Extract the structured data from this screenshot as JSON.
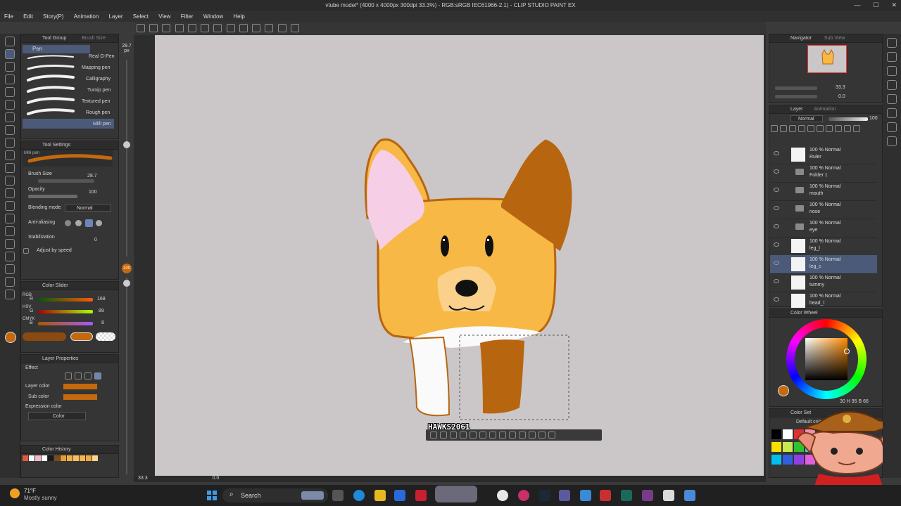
{
  "title_bar": {
    "text": "vtube model* (4000 x 4000px 300dpi 33.3%) - RGB:sRGB IEC61966-2.1) - CLIP STUDIO PAINT EX",
    "min": "—",
    "max": "☐",
    "close": "✕"
  },
  "menu": [
    "File",
    "Edit",
    "Story(P)",
    "Animation",
    "Layer",
    "Select",
    "View",
    "Filter",
    "Window",
    "Help"
  ],
  "tool_group": {
    "tab1": "Tool Group",
    "tab2": "Brush Size",
    "selected_tool": "Pen",
    "size_readout": "28.7",
    "size_unit": "px",
    "brushes": [
      "Real G-Pen",
      "Mapping pen",
      "Calligraphy",
      "Turnip pen",
      "Textured pen",
      "Rough pen",
      "Milli pen"
    ]
  },
  "tool_settings": {
    "header": "Tool Settings",
    "preview_label": "Milli pen",
    "brush_size_label": "Brush Size",
    "brush_size_value": "28.7",
    "opacity_label": "Opacity",
    "opacity_value": "100",
    "blending_label": "Blending mode",
    "blending_value": "Normal",
    "antialias_label": "Anti-aliasing",
    "stabilization_label": "Stabilization",
    "stabilization_value": "0",
    "adjust_speed_label": "Adjust by speed",
    "opacity_indicator": "100"
  },
  "color_slider": {
    "header": "Color Slider",
    "r_label": "R",
    "r_value": "168",
    "g_label": "G",
    "g_value": "89",
    "b_label": "B",
    "b_value": "8",
    "modes": [
      "RGB",
      "HSV",
      "CMYK"
    ]
  },
  "layer_properties": {
    "header": "Layer Properties",
    "effect_label": "Effect",
    "layer_color_label": "Layer color",
    "sub_color_label": "Sub color",
    "expression_label": "Expression color",
    "expression_value": "Color",
    "layer_color": "#c4690e"
  },
  "color_history": {
    "header": "Color History",
    "colors": [
      "#e05a3a",
      "#f7f7f7",
      "#f1b8c8",
      "#ffffff",
      "#1a1a1a",
      "#7a4a20",
      "#e6a030",
      "#f0b040",
      "#f5c060",
      "#f8b54a",
      "#f2a83c",
      "#fcd68a"
    ]
  },
  "canvas": {
    "watermark": "HAWKS2061",
    "status_zoom": "33.3",
    "status_angle": "0.0"
  },
  "navigator": {
    "tab1": "Navigator",
    "tab2": "Sub View",
    "zoom_value": "33.3",
    "angle_value": "0.0"
  },
  "layer_panel": {
    "tab1": "Layer",
    "tab2": "Animation",
    "blend_mode": "Normal",
    "opacity": "100",
    "layers": [
      {
        "mode": "100 % Normal",
        "name": "Ruler",
        "type": "layer"
      },
      {
        "mode": "100 % Normal",
        "name": "Folder 1",
        "type": "folder"
      },
      {
        "mode": "100 % Normal",
        "name": "mouth",
        "type": "folder"
      },
      {
        "mode": "100 % Normal",
        "name": "nose",
        "type": "folder"
      },
      {
        "mode": "100 % Normal",
        "name": "eye",
        "type": "folder"
      },
      {
        "mode": "100 % Normal",
        "name": "leg_l",
        "type": "layer"
      },
      {
        "mode": "100 % Normal",
        "name": "leg_c",
        "type": "layer"
      },
      {
        "mode": "100 % Normal",
        "name": "tummy",
        "type": "layer"
      },
      {
        "mode": "100 % Normal",
        "name": "head_l",
        "type": "layer"
      },
      {
        "mode": "100 % Normal",
        "name": "",
        "type": "layer"
      }
    ]
  },
  "color_wheel": {
    "header": "Color Wheel",
    "readout": "30 H 95 B 66"
  },
  "color_set": {
    "header": "Color Set",
    "default_label": "Default color set"
  },
  "taskbar": {
    "weather_temp": "71°F",
    "weather_desc": "Mostly sunny",
    "search_label": "Search"
  },
  "colors": {
    "corgi_orange": "#f7b845",
    "corgi_brown": "#b8650f",
    "ear_pink": "#f6cfe6",
    "snout": "#fad08a",
    "outline": "#b8650f",
    "canvas_bg": "#cbc6c7",
    "accent": "#c4690e"
  }
}
